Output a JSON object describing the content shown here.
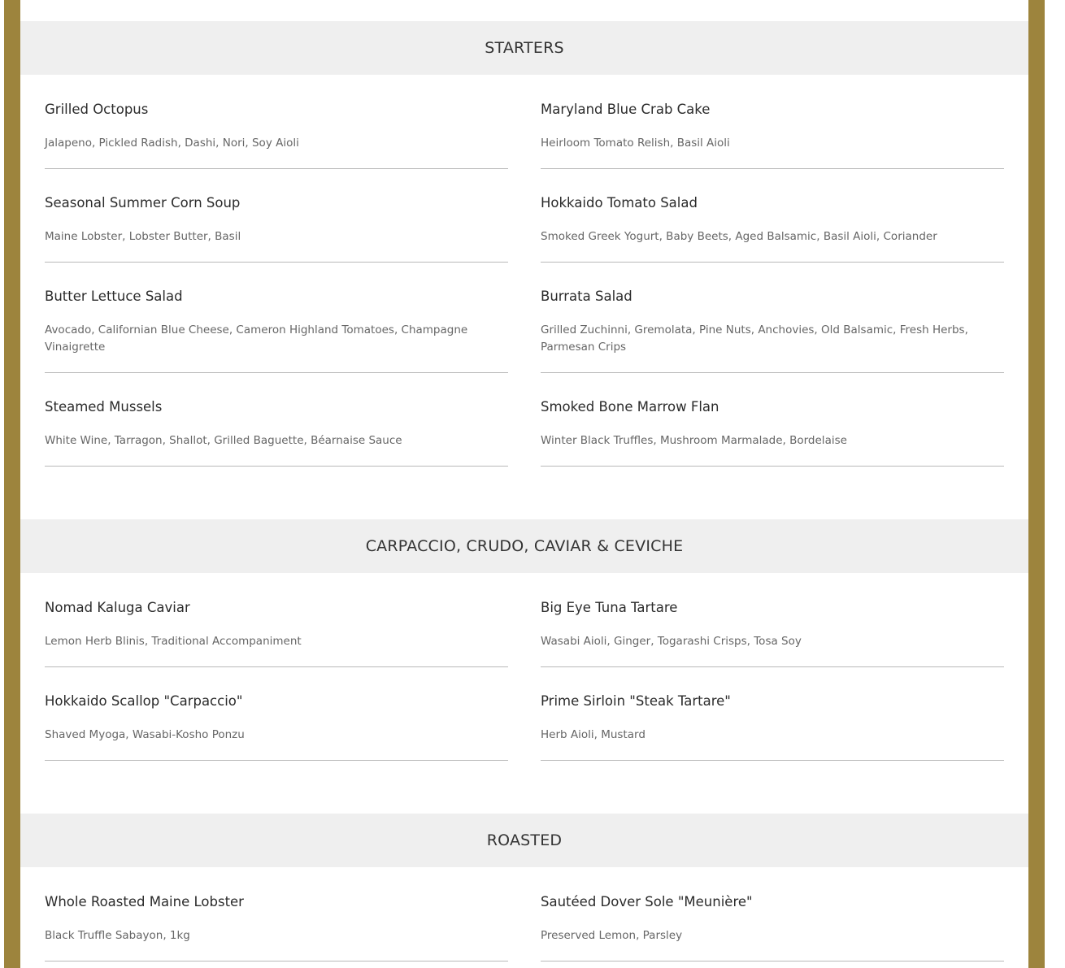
{
  "sections": [
    {
      "title": "STARTERS",
      "items": [
        {
          "name": "Grilled Octopus",
          "desc": "Jalapeno, Pickled Radish, Dashi, Nori, Soy Aioli"
        },
        {
          "name": "Maryland Blue Crab Cake",
          "desc": "Heirloom Tomato Relish, Basil Aioli"
        },
        {
          "name": "Seasonal Summer Corn Soup",
          "desc": "Maine Lobster, Lobster Butter, Basil"
        },
        {
          "name": "Hokkaido Tomato Salad",
          "desc": "Smoked Greek Yogurt, Baby Beets, Aged Balsamic, Basil Aioli, Coriander"
        },
        {
          "name": "Butter Lettuce Salad",
          "desc": "Avocado, Californian Blue Cheese, Cameron Highland Tomatoes, Champagne Vinaigrette"
        },
        {
          "name": "Burrata Salad",
          "desc": "Grilled Zuchinni, Gremolata, Pine Nuts, Anchovies, Old Balsamic, Fresh Herbs, Parmesan Crips"
        },
        {
          "name": "Steamed Mussels",
          "desc": "White Wine, Tarragon, Shallot, Grilled Baguette, Béarnaise Sauce"
        },
        {
          "name": "Smoked Bone Marrow Flan",
          "desc": "Winter Black Truffles, Mushroom Marmalade, Bordelaise"
        }
      ]
    },
    {
      "title": "CARPACCIO, CRUDO, CAVIAR & CEVICHE",
      "items": [
        {
          "name": "Nomad Kaluga Caviar",
          "desc": "Lemon Herb Blinis, Traditional Accompaniment"
        },
        {
          "name": "Big Eye Tuna Tartare",
          "desc": "Wasabi Aioli, Ginger, Togarashi Crisps, Tosa Soy"
        },
        {
          "name": "Hokkaido Scallop \"Carpaccio\"",
          "desc": "Shaved Myoga, Wasabi-Kosho Ponzu"
        },
        {
          "name": "Prime Sirloin \"Steak Tartare\"",
          "desc": "Herb Aioli, Mustard"
        }
      ]
    },
    {
      "title": "ROASTED",
      "items": [
        {
          "name": "Whole Roasted Maine Lobster",
          "desc": "Black Truffle Sabayon, 1kg"
        },
        {
          "name": "Sautéed Dover Sole \"Meunière\"",
          "desc": "Preserved Lemon, Parsley"
        }
      ]
    }
  ],
  "colors": {
    "border_gold": "#9d843d",
    "header_bg": "#efefef",
    "divider": "#b9b9b9"
  }
}
